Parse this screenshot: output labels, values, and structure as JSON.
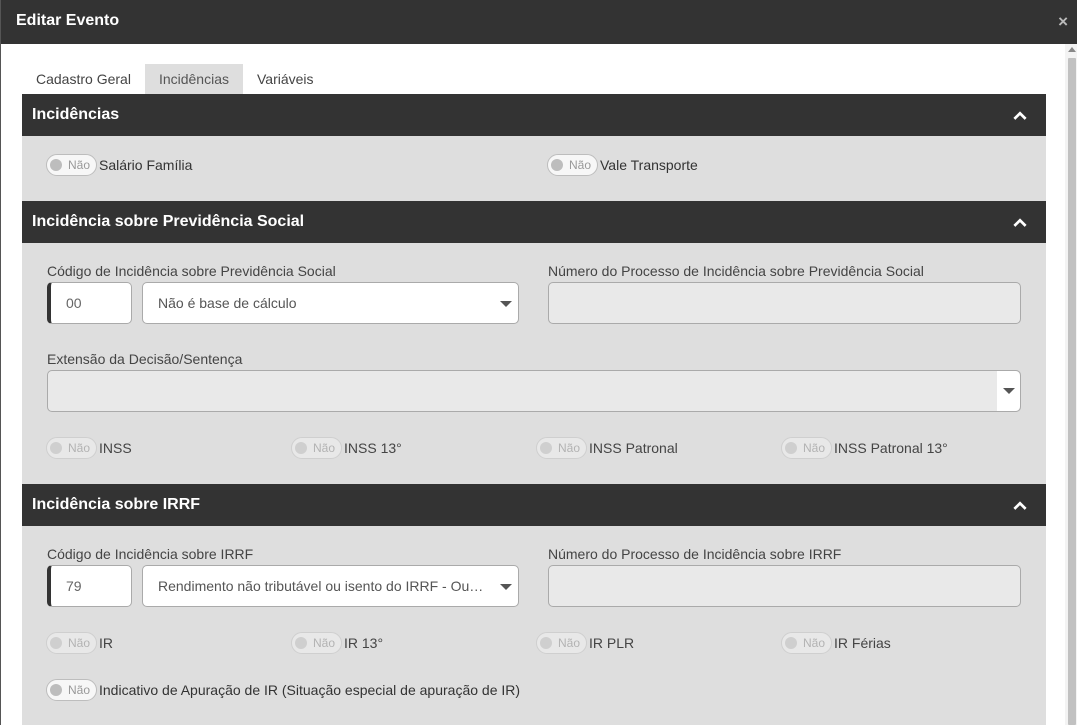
{
  "window": {
    "title": "Editar Evento",
    "close_glyph": "×"
  },
  "tabs": [
    {
      "label": "Cadastro Geral",
      "active": false
    },
    {
      "label": "Incidências",
      "active": true
    },
    {
      "label": "Variáveis",
      "active": false
    }
  ],
  "toggle_off_text": "Não",
  "sections": {
    "incidencias": {
      "title": "Incidências",
      "toggles": [
        {
          "label": "Salário Família",
          "value": "Não"
        },
        {
          "label": "Vale Transporte",
          "value": "Não"
        }
      ]
    },
    "previdencia": {
      "title": "Incidência sobre Previdência Social",
      "code_label": "Código de Incidência sobre Previdência Social",
      "code_value": "00",
      "code_select": "Não é base de cálculo",
      "process_label": "Número do Processo de Incidência sobre Previdência Social",
      "process_value": "",
      "extension_label": "Extensão da Decisão/Sentença",
      "extension_value": "",
      "toggles": [
        {
          "label": "INSS",
          "value": "Não"
        },
        {
          "label": "INSS 13°",
          "value": "Não"
        },
        {
          "label": "INSS Patronal",
          "value": "Não"
        },
        {
          "label": "INSS Patronal 13°",
          "value": "Não"
        }
      ]
    },
    "irrf": {
      "title": "Incidência sobre IRRF",
      "code_label": "Código de Incidência sobre IRRF",
      "code_value": "79",
      "code_select": "Rendimento não tributável ou isento do IRRF - Outros",
      "process_label": "Número do Processo de Incidência sobre IRRF",
      "process_value": "",
      "toggles": [
        {
          "label": "IR",
          "value": "Não"
        },
        {
          "label": "IR 13°",
          "value": "Não"
        },
        {
          "label": "IR PLR",
          "value": "Não"
        },
        {
          "label": "IR Férias",
          "value": "Não"
        }
      ],
      "indicativo": {
        "label": "Indicativo de Apuração de IR (Situação especial de apuração de IR)",
        "value": "Não"
      }
    }
  },
  "icons": {
    "close": "close-icon",
    "collapse": "chevron-up-icon",
    "dropdown": "caret-down-icon"
  }
}
